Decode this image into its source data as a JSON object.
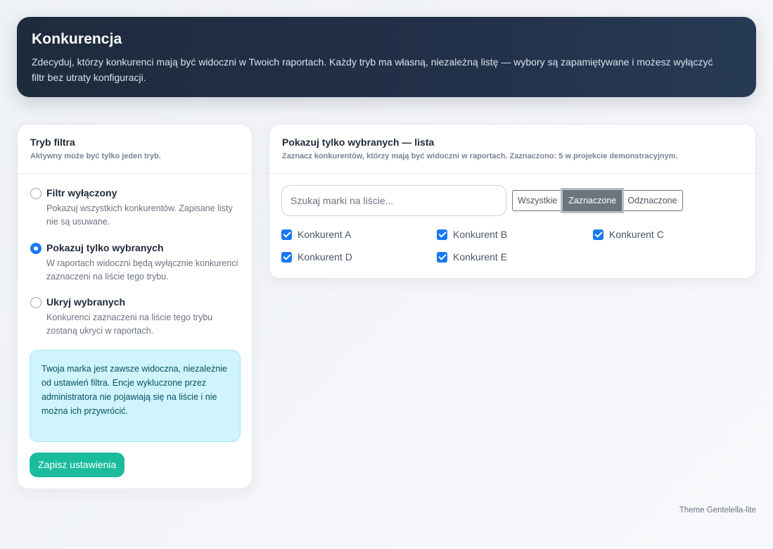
{
  "header": {
    "title": "Konkurencja",
    "description": "Zdecyduj, którzy konkurenci mają być widoczni w Twoich raportach. Każdy tryb ma własną, niezależną listę — wybory są zapamiętywane i możesz wyłączyć filtr bez utraty konfiguracji."
  },
  "filter_mode": {
    "title": "Tryb filtra",
    "subtitle": "Aktywny może być tylko jeden tryb.",
    "options": [
      {
        "label": "Filtr wyłączony",
        "description": "Pokazuj wszystkich konkurentów. Zapisane listy nie są usuwane.",
        "selected": false
      },
      {
        "label": "Pokazuj tylko wybranych",
        "description": "W raportach widoczni będą wyłącznie konkurenci zaznaczeni na liście tego trybu.",
        "selected": true
      },
      {
        "label": "Ukryj wybranych",
        "description": "Konkurenci zaznaczeni na liście tego trybu zostaną ukryci w raportach.",
        "selected": false
      }
    ],
    "info": "Twoja marka jest zawsze widoczna, niezależnie od ustawień filtra. Encje wykluczone przez administratora nie pojawiają się na liście i nie można ich przywrócić.",
    "save_label": "Zapisz ustawienia"
  },
  "list_panel": {
    "title": "Pokazuj tylko wybranych — lista",
    "subtitle": "Zaznacz konkurentów, którzy mają być widoczni w raportach. Zaznaczono: 5 w projekcie demonstracyjnym.",
    "search_placeholder": "Szukaj marki na liście...",
    "segments": [
      "Wszystkie",
      "Zaznaczone",
      "Odznaczone"
    ],
    "active_segment": "Zaznaczone",
    "competitors": [
      {
        "name": "Konkurent A",
        "checked": true
      },
      {
        "name": "Konkurent B",
        "checked": true
      },
      {
        "name": "Konkurent C",
        "checked": true
      },
      {
        "name": "Konkurent D",
        "checked": true
      },
      {
        "name": "Konkurent E",
        "checked": true
      }
    ]
  },
  "footer": {
    "text": "Theme Gentelella-lite"
  },
  "colors": {
    "header_bg": "#1e2b3c",
    "accent": "#1877f2",
    "save_button": "#1abc9c",
    "info_bg": "#cff4fc"
  }
}
